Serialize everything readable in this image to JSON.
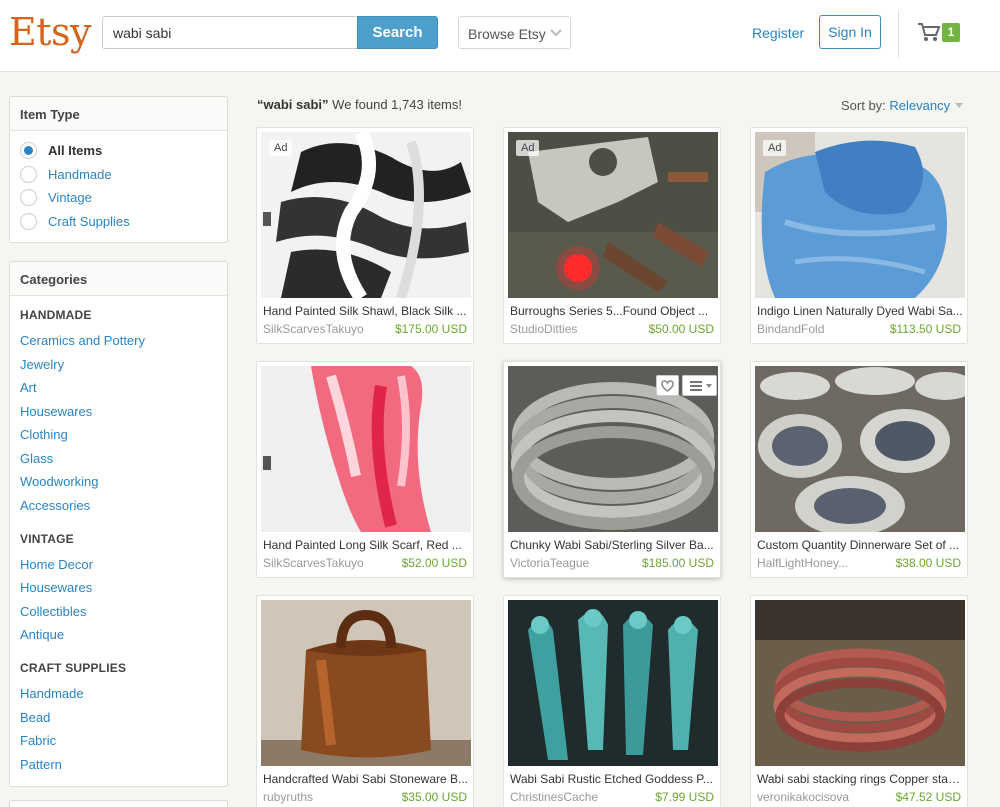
{
  "header": {
    "logo": "Etsy",
    "search_value": "wabi sabi",
    "search_button": "Search",
    "browse_label": "Browse Etsy",
    "register": "Register",
    "sign_in": "Sign In",
    "cart_count": "1"
  },
  "item_type": {
    "heading": "Item Type",
    "options": [
      {
        "label": "All Items",
        "selected": true
      },
      {
        "label": "Handmade",
        "selected": false
      },
      {
        "label": "Vintage",
        "selected": false
      },
      {
        "label": "Craft Supplies",
        "selected": false
      }
    ]
  },
  "categories": {
    "heading": "Categories",
    "groups": [
      {
        "name": "HANDMADE",
        "items": [
          "Ceramics and Pottery",
          "Jewelry",
          "Art",
          "Housewares",
          "Clothing",
          "Glass",
          "Woodworking",
          "Accessories"
        ]
      },
      {
        "name": "VINTAGE",
        "items": [
          "Home Decor",
          "Housewares",
          "Collectibles",
          "Antique"
        ]
      },
      {
        "name": "CRAFT SUPPLIES",
        "items": [
          "Handmade",
          "Bead",
          "Fabric",
          "Pattern"
        ]
      }
    ]
  },
  "results": {
    "query": "“wabi sabi”",
    "count_text": "We found 1,743 items!",
    "sort_label": "Sort by:",
    "sort_value": "Relevancy"
  },
  "listings": [
    {
      "title": "Hand Painted Silk Shawl, Black Silk ...",
      "shop": "SilkScarvesTakuyo",
      "price": "$175.00 USD",
      "ad": "Ad",
      "image": "black-white-silk-shawl"
    },
    {
      "title": "Burroughs Series 5...Found Object ...",
      "shop": "StudioDitties",
      "price": "$50.00 USD",
      "ad": "Ad",
      "image": "found-object-metal-art"
    },
    {
      "title": "Indigo Linen Naturally Dyed Wabi Sa...",
      "shop": "BindandFold",
      "price": "$113.50 USD",
      "ad": "Ad",
      "image": "indigo-linen-blanket"
    },
    {
      "title": "Hand Painted Long Silk Scarf, Red ...",
      "shop": "SilkScarvesTakuyo",
      "price": "$52.00 USD",
      "ad": "",
      "image": "red-silk-scarf"
    },
    {
      "title": "Chunky Wabi Sabi/Sterling Silver Ba...",
      "shop": "VictoriaTeague",
      "price": "$185.00 USD",
      "ad": "",
      "image": "silver-bangles"
    },
    {
      "title": "Custom Quantity Dinnerware Set of ...",
      "shop": "HalfLightHoney...",
      "price": "$38.00 USD",
      "ad": "",
      "image": "dinnerware-plates"
    },
    {
      "title": "Handcrafted Wabi Sabi Stoneware B...",
      "shop": "rubyruths",
      "price": "$35.00 USD",
      "ad": "",
      "image": "stoneware-jar"
    },
    {
      "title": "Wabi Sabi Rustic Etched Goddess P...",
      "shop": "ChristinesCache",
      "price": "$7.99 USD",
      "ad": "",
      "image": "goddess-pendants"
    },
    {
      "title": "Wabi sabi stacking rings Copper stac...",
      "shop": "veronikakocisova",
      "price": "$47.52 USD",
      "ad": "",
      "image": "copper-stacking-rings"
    }
  ],
  "colors": {
    "brand": "#d5641c",
    "link": "#2a83c3",
    "search_button": "#4f9fcd",
    "price": "#6aa62e",
    "cart_badge": "#71b442"
  }
}
